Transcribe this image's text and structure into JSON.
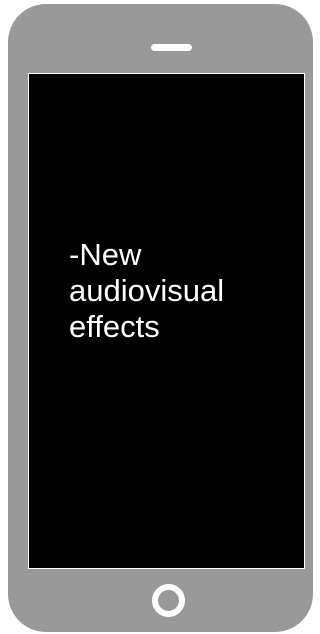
{
  "device": {
    "frame_color": "#999999",
    "screen_color": "#000000"
  },
  "screen": {
    "lines": [
      "-New",
      "audiovisual",
      "effects"
    ]
  },
  "icons": {
    "speaker": "speaker-grille-icon",
    "home": "home-button-icon"
  }
}
